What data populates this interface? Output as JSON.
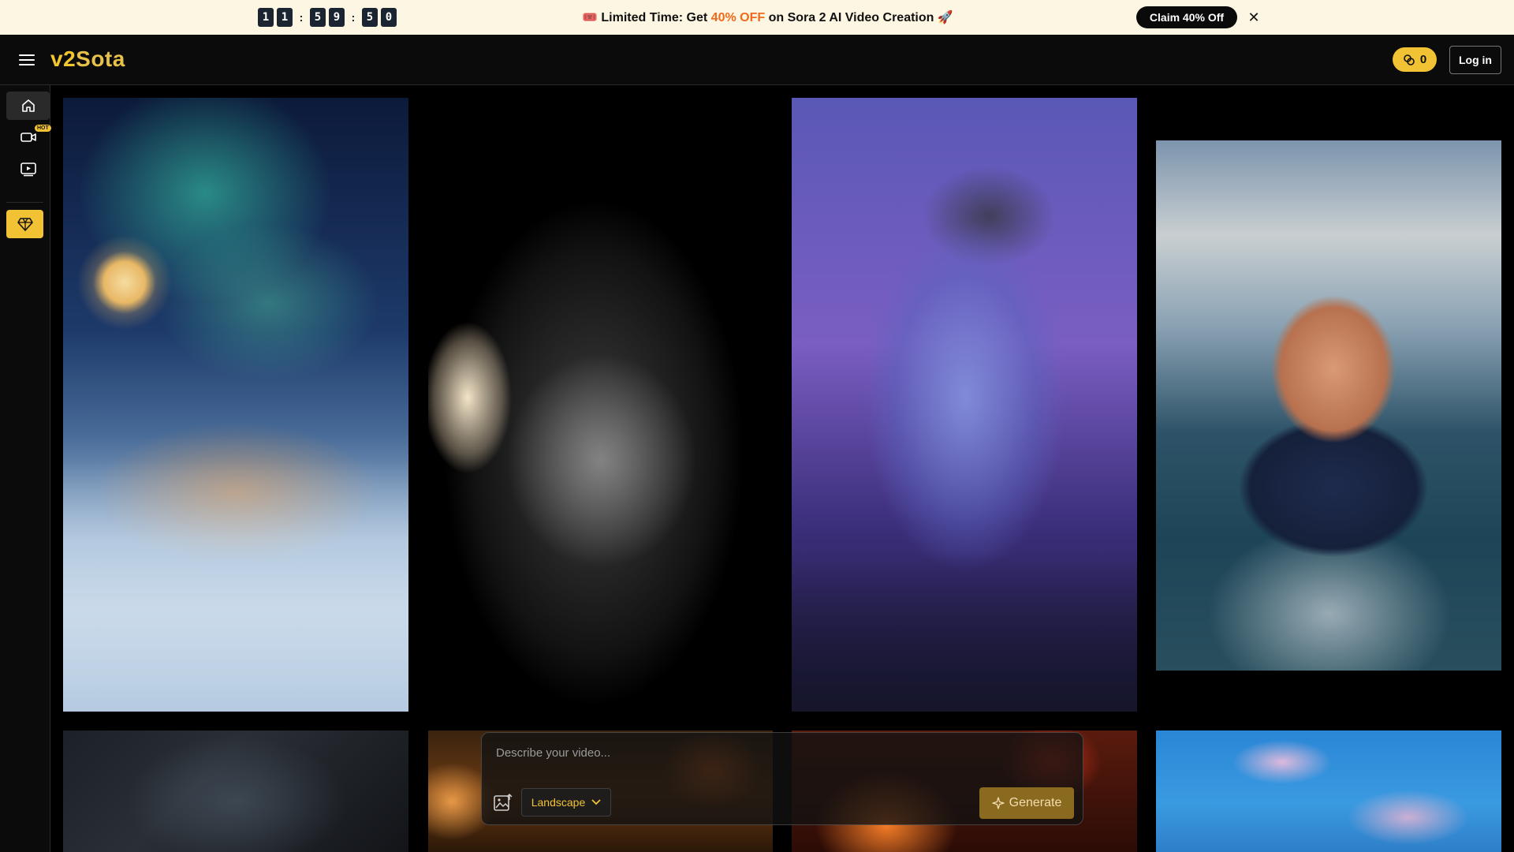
{
  "promo": {
    "countdown": [
      "1",
      "1",
      ":",
      "5",
      "9",
      ":",
      "5",
      "0"
    ],
    "message_prefix": "Limited Time: Get",
    "message_highlight": "40% OFF",
    "message_suffix": "on Sora 2 AI Video Creation",
    "emoji_start": "🎟️",
    "emoji_end": "🚀",
    "cta_label": "Claim 40% Off",
    "close_glyph": "✕"
  },
  "header": {
    "logo_v2": "v2",
    "logo_rest": "Sota",
    "credits": "0",
    "login_label": "Log in"
  },
  "sidebar": {
    "hot_badge": "HOT"
  },
  "prompt": {
    "placeholder": "Describe your video...",
    "orientation": "Landscape",
    "generate_label": "Generate"
  },
  "colors": {
    "accent": "#f1c233",
    "promo_highlight": "#ef6a1a",
    "promo_bg": "#fdf6e3"
  }
}
